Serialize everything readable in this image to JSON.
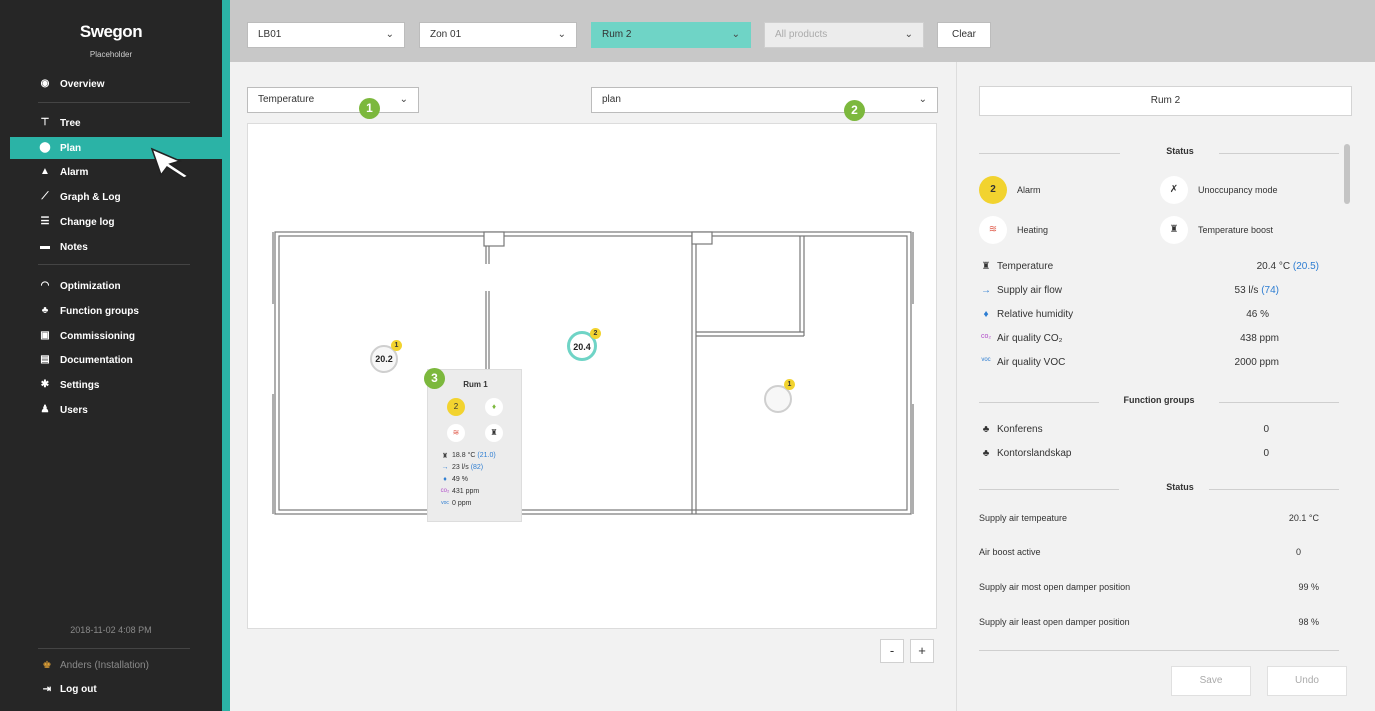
{
  "sidebar": {
    "logo": "Swegon",
    "subtitle": "Placeholder",
    "items": [
      {
        "label": "Overview",
        "icon": "eye-icon"
      },
      {
        "label": "Tree",
        "icon": "tree-icon"
      },
      {
        "label": "Plan",
        "icon": "pin-icon",
        "active": true
      },
      {
        "label": "Alarm",
        "icon": "bell-icon"
      },
      {
        "label": "Graph & Log",
        "icon": "graph-icon"
      },
      {
        "label": "Change log",
        "icon": "list-icon"
      },
      {
        "label": "Notes",
        "icon": "notes-icon"
      },
      {
        "label": "Optimization",
        "icon": "gauge-icon"
      },
      {
        "label": "Function groups",
        "icon": "function-groups-icon"
      },
      {
        "label": "Commissioning",
        "icon": "commissioning-icon"
      },
      {
        "label": "Documentation",
        "icon": "document-icon"
      },
      {
        "label": "Settings",
        "icon": "gear-icon"
      },
      {
        "label": "Users",
        "icon": "users-icon"
      }
    ],
    "datetime": "2018-11-02 4:08 PM",
    "user": "Anders (Installation)",
    "logout": "Log out"
  },
  "topbar": {
    "site": "LB01",
    "zone": "Zon 01",
    "room": "Rum 2",
    "products_placeholder": "All products",
    "clear": "Clear"
  },
  "main": {
    "view_select": "Temperature",
    "plan_select": "plan",
    "markers": [
      "1",
      "2",
      "3"
    ],
    "rooms": [
      {
        "value": "20.2",
        "badge": "1"
      },
      {
        "value": "20.4",
        "badge": "2"
      },
      {
        "value": "",
        "badge": "1"
      }
    ],
    "popup": {
      "title": "Rum 1",
      "alarm_count": "2",
      "temperature": "18.8 °C",
      "temperature_setpoint": "(21.0)",
      "airflow": "23 l/s",
      "airflow_setpoint": "(82)",
      "humidity": "49 %",
      "co2": "431 ppm",
      "voc": "0 ppm"
    },
    "zoom_out": "-",
    "zoom_in": "+"
  },
  "panel": {
    "room_name": "Rum 2",
    "status_title": "Status",
    "modes": [
      {
        "label": "Alarm",
        "badge": "2"
      },
      {
        "label": "Unoccupancy mode"
      },
      {
        "label": "Heating"
      },
      {
        "label": "Temperature boost"
      }
    ],
    "measurements": [
      {
        "label": "Temperature",
        "value": "20.4 °C",
        "setpoint": "(20.5)",
        "icon": "thermometer-icon"
      },
      {
        "label": "Supply air flow",
        "value": "53 l/s",
        "setpoint": "(74)",
        "icon": "arrow-right-icon"
      },
      {
        "label": "Relative humidity",
        "value": "46 %",
        "setpoint": "",
        "icon": "droplet-icon"
      },
      {
        "label": "Air quality CO₂",
        "value": "438 ppm",
        "setpoint": "",
        "icon": "co2-icon"
      },
      {
        "label": "Air quality VOC",
        "value": "2000 ppm",
        "setpoint": "",
        "icon": "voc-icon"
      }
    ],
    "function_groups_title": "Function groups",
    "function_groups": [
      {
        "label": "Konferens",
        "value": "0"
      },
      {
        "label": "Kontorslandskap",
        "value": "0"
      }
    ],
    "status2_title": "Status",
    "status_rows": [
      {
        "label": "Supply air tempeature",
        "value": "20.1 °C"
      },
      {
        "label": "Air boost active",
        "value": "0"
      },
      {
        "label": "Supply air most open damper position",
        "value": "99 %"
      },
      {
        "label": "Supply air least open damper position",
        "value": "98 %"
      }
    ],
    "save": "Save",
    "undo": "Undo"
  },
  "colors": {
    "accent": "#2bb3a6",
    "sidebar_bg": "#262626",
    "marker_green": "#7cb83d",
    "alarm_yellow": "#f2d32f"
  }
}
